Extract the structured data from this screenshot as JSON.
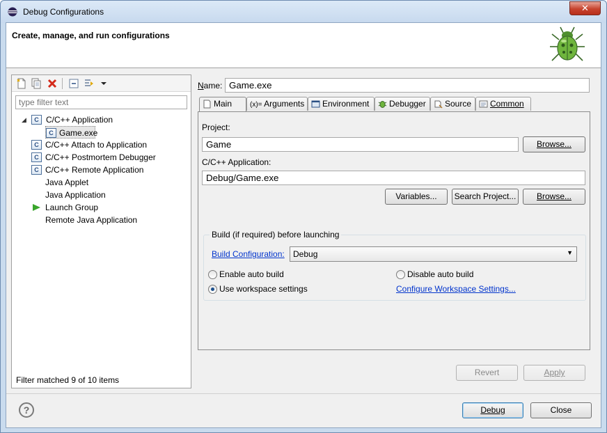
{
  "window": {
    "title": "Debug Configurations",
    "close_glyph": "✕"
  },
  "header": {
    "title": "Create, manage, and run configurations"
  },
  "left": {
    "filter_placeholder": "type filter text",
    "tree": [
      {
        "label": "C/C++ Application",
        "icon": "c-config-icon",
        "expanded": true,
        "level": 0
      },
      {
        "label": "Game.exe",
        "icon": "c-config-icon",
        "level": 1,
        "selected": true
      },
      {
        "label": "C/C++ Attach to Application",
        "icon": "c-config-icon",
        "level": 0
      },
      {
        "label": "C/C++ Postmortem Debugger",
        "icon": "c-config-icon",
        "level": 0
      },
      {
        "label": "C/C++ Remote Application",
        "icon": "c-config-icon",
        "level": 0
      },
      {
        "label": "Java Applet",
        "level": 0
      },
      {
        "label": "Java Application",
        "level": 0
      },
      {
        "label": "Launch Group",
        "icon": "green-arrow-icon",
        "level": 0
      },
      {
        "label": "Remote Java Application",
        "level": 0
      }
    ],
    "status": "Filter matched 9 of 10 items"
  },
  "config": {
    "name_label": "Name:",
    "name_value": "Game.exe",
    "tabs": [
      {
        "label": "Main",
        "icon": "main-tab-icon",
        "active": true
      },
      {
        "label": "Arguments",
        "icon": "arguments-tab-icon",
        "prefix": "(x)="
      },
      {
        "label": "Environment",
        "icon": "environment-tab-icon"
      },
      {
        "label": "Debugger",
        "icon": "debugger-tab-icon"
      },
      {
        "label": "Source",
        "icon": "source-tab-icon"
      },
      {
        "label": "Common",
        "icon": "common-tab-icon"
      }
    ],
    "main": {
      "project_label": "Project:",
      "project_value": "Game",
      "browse_label": "Browse...",
      "app_label": "C/C++ Application:",
      "app_value": "Debug/Game.exe",
      "variables_label": "Variables...",
      "search_project_label": "Search Project...",
      "browse2_label": "Browse...",
      "build_group_title": "Build (if required) before launching",
      "build_config_link": "Build Configuration:",
      "build_config_value": "Debug",
      "enable_auto_build": "Enable auto build",
      "disable_auto_build": "Disable auto build",
      "use_workspace": "Use workspace settings",
      "configure_workspace_link": "Configure Workspace Settings..."
    },
    "revert_label": "Revert",
    "apply_label": "Apply"
  },
  "footer": {
    "help_glyph": "?",
    "debug_label": "Debug",
    "close_label": "Close"
  }
}
